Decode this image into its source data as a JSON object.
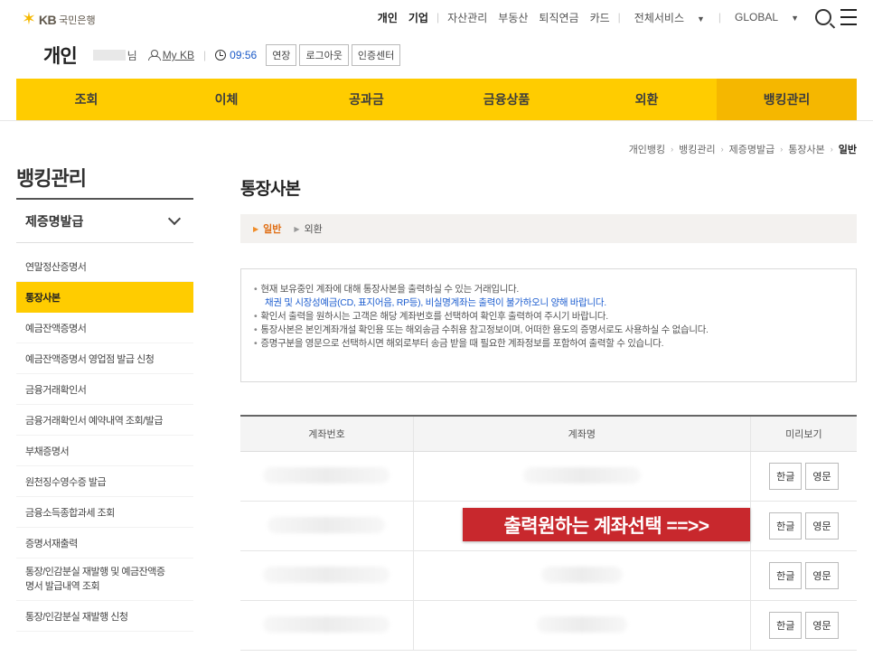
{
  "brand": {
    "name": "KB",
    "bank": "국민은행"
  },
  "topnav": {
    "personal": "개인",
    "corporate": "기업",
    "links": [
      "자산관리",
      "부동산",
      "퇴직연금",
      "카드"
    ],
    "all_services": "전체서비스",
    "global": "GLOBAL"
  },
  "userbar": {
    "section": "개인",
    "honorific": "님",
    "mykb": "My KB",
    "time": "09:56",
    "buttons": [
      "연장",
      "로그아웃",
      "인증센터"
    ]
  },
  "gnb": {
    "items": [
      "조회",
      "이체",
      "공과금",
      "금융상품",
      "외환",
      "뱅킹관리"
    ],
    "active": "뱅킹관리"
  },
  "lnb": {
    "title": "뱅킹관리",
    "group": "제증명발급",
    "items": [
      "연말정산증명서",
      "통장사본",
      "예금잔액증명서",
      "예금잔액증명서 영업점 발급 신청",
      "금융거래확인서",
      "금융거래확인서 예약내역 조회/발급",
      "부채증명서",
      "원천징수영수증 발급",
      "금융소득종합과세 조회",
      "증명서재출력",
      "통장/인감분실 재발행 및 예금잔액증명서 발급내역 조회",
      "통장/인감분실 재발행 신청"
    ],
    "item_12_line1": "통장/인감분실 재발행 및 예금잔액증",
    "item_12_line2": "명서 발급내역 조회"
  },
  "breadcrumb": [
    "개인뱅킹",
    "뱅킹관리",
    "제증명발급",
    "통장사본",
    "일반"
  ],
  "page": {
    "title": "통장사본",
    "tabs": [
      "일반",
      "외환"
    ],
    "active_tab": "일반"
  },
  "notice": {
    "lines": [
      "현재 보유중인 계좌에 대해 통장사본을 출력하실 수 있는 거래입니다.",
      "확인서 출력을 원하시는 고객은 해당 계좌번호를 선택하여 확인후 출력하여 주시기 바랍니다.",
      "통장사본은 본인계좌개설 확인용 또는 해외송금 수취용 참고정보이며, 어떠한 용도의 증명서로도 사용하실 수 없습니다.",
      "증명구분을 영문으로 선택하시면 해외로부터 송금 받을 때 필요한 계좌정보를 포함하여 출력할 수 있습니다."
    ],
    "blue_note": "채권 및 시장성예금(CD, 표지어음, RP등), 비실명계좌는 출력이 불가하오니 양해 바랍니다."
  },
  "table": {
    "headers": [
      "계좌번호",
      "계좌명",
      "미리보기"
    ],
    "row_count": 4,
    "korean_btn": "한글",
    "english_btn": "영문"
  },
  "overlay_text": "출력원하는 계좌선택 ==>>",
  "colors": {
    "accent": "#ffcc00",
    "accent_active": "#f5b700",
    "overlay": "#c8282d",
    "link_blue": "#1f5fd0",
    "tab_orange": "#e06e14"
  }
}
